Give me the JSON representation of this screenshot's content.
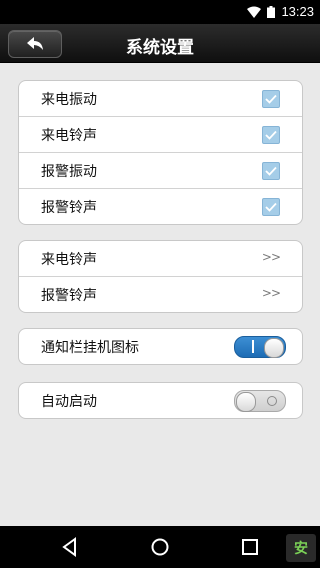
{
  "status_bar": {
    "time": "13:23"
  },
  "header": {
    "title": "系统设置"
  },
  "groups": {
    "vibrate_ring": [
      {
        "label": "来电振动",
        "checked": true
      },
      {
        "label": "来电铃声",
        "checked": true
      },
      {
        "label": "报警振动",
        "checked": true
      },
      {
        "label": "报警铃声",
        "checked": true
      }
    ],
    "ringtones": [
      {
        "label": "来电铃声",
        "chevron": ">>"
      },
      {
        "label": "报警铃声",
        "chevron": ">>"
      }
    ],
    "notify_icon": {
      "label": "通知栏挂机图标",
      "enabled": true
    },
    "auto_start": {
      "label": "自动启动",
      "enabled": false
    }
  },
  "icons": {
    "back": "back-arrow-icon",
    "wifi": "wifi-icon",
    "battery": "battery-icon",
    "nav_back": "nav-back-icon",
    "nav_home": "nav-home-icon",
    "nav_recent": "nav-recent-icon"
  },
  "colors": {
    "header_bg": "#1a1a1a",
    "checkbox": "#a5cde8",
    "toggle_on": "#2a7bc3",
    "page_bg": "#e9e9e9"
  }
}
